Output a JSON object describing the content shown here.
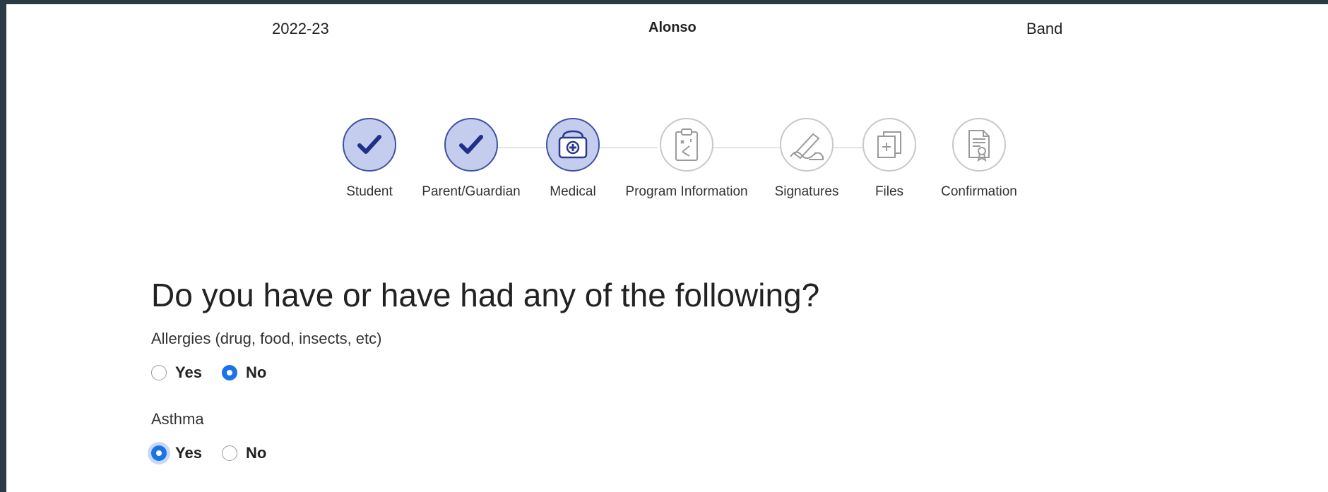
{
  "header": {
    "school_year": "2022-23",
    "student_name": "Alonso",
    "program": "Band"
  },
  "stepper": {
    "steps": [
      {
        "label": "Student",
        "status": "done",
        "icon": "check-icon"
      },
      {
        "label": "Parent/Guardian",
        "status": "done",
        "icon": "check-icon"
      },
      {
        "label": "Medical",
        "status": "active",
        "icon": "medical-kit-icon"
      },
      {
        "label": "Program Information",
        "status": "todo",
        "icon": "clipboard-diagram-icon"
      },
      {
        "label": "Signatures",
        "status": "todo",
        "icon": "signature-pen-icon"
      },
      {
        "label": "Files",
        "status": "todo",
        "icon": "files-add-icon"
      },
      {
        "label": "Confirmation",
        "status": "todo",
        "icon": "certificate-icon"
      }
    ]
  },
  "form": {
    "question": "Do you have or have had any of the following?",
    "fields": [
      {
        "label": "Allergies (drug, food, insects, etc)",
        "options": [
          "Yes",
          "No"
        ],
        "selected": "No"
      },
      {
        "label": "Asthma",
        "options": [
          "Yes",
          "No"
        ],
        "selected": "Yes"
      }
    ]
  },
  "colors": {
    "accent": "#1a73e8",
    "step_done_fill": "#c5cdef",
    "step_done_border": "#3f51a5",
    "check": "#1f2f8a"
  }
}
